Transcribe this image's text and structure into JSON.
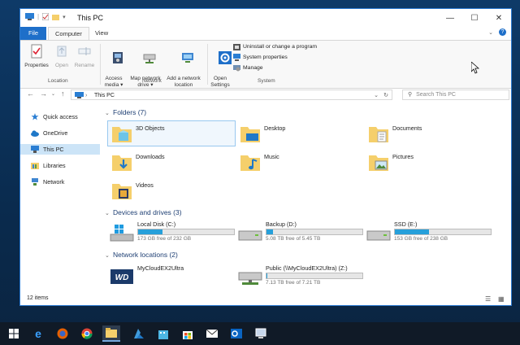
{
  "window": {
    "title": "This PC",
    "controls": {
      "minimize": "—",
      "maximize": "☐",
      "close": "✕"
    }
  },
  "ribbon": {
    "tabs": [
      "File",
      "Computer",
      "View"
    ],
    "location": {
      "label": "Location",
      "buttons": [
        {
          "label": "Properties",
          "icon": "properties-icon",
          "enabled": true
        },
        {
          "label": "Open",
          "icon": "open-icon",
          "enabled": false
        },
        {
          "label": "Rename",
          "icon": "rename-icon",
          "enabled": false
        }
      ]
    },
    "network": {
      "label": "Network",
      "buttons": [
        {
          "label": "Access\nmedia ▾",
          "icon": "access-media-icon"
        },
        {
          "label": "Map network\ndrive ▾",
          "icon": "map-network-drive-icon"
        },
        {
          "label": "Add a network\nlocation",
          "icon": "add-network-location-icon"
        }
      ]
    },
    "system": {
      "label": "System",
      "open_settings": "Open\nSettings",
      "items": [
        "Uninstall or change a program",
        "System properties",
        "Manage"
      ]
    }
  },
  "navbar": {
    "address": "This PC",
    "search_placeholder": "Search This PC"
  },
  "navpane": {
    "items": [
      {
        "label": "Quick access",
        "icon": "star-icon",
        "selected": false
      },
      {
        "label": "OneDrive",
        "icon": "cloud-icon",
        "selected": false
      },
      {
        "label": "This PC",
        "icon": "computer-icon",
        "selected": true
      },
      {
        "label": "Libraries",
        "icon": "library-icon",
        "selected": false
      },
      {
        "label": "Network",
        "icon": "network-icon",
        "selected": false
      }
    ]
  },
  "folders": {
    "header": "Folders (7)",
    "items": [
      "3D Objects",
      "Desktop",
      "Documents",
      "Downloads",
      "Music",
      "Pictures",
      "Videos"
    ]
  },
  "drives": {
    "header": "Devices and drives (3)",
    "items": [
      {
        "name": "Local Disk (C:)",
        "space": "173 GB free of 232 GB",
        "used_fraction": 0.25
      },
      {
        "name": "Backup (D:)",
        "space": "5.08 TB free of 5.45 TB",
        "used_fraction": 0.07
      },
      {
        "name": "SSD (E:)",
        "space": "153 GB free of 238 GB",
        "used_fraction": 0.36
      }
    ]
  },
  "network_locations": {
    "header": "Network locations (2)",
    "items": [
      {
        "name": "MyCloudEX2Ultra",
        "logo_text": "WD"
      },
      {
        "name": "Public (\\\\MyCloudEX2Ultra) (Z:)",
        "space": "7.13 TB free of 7.21 TB",
        "used_fraction": 0.01
      }
    ]
  },
  "statusbar": {
    "count": "12 items"
  },
  "colors": {
    "accent": "#1e6fc9",
    "selection": "#cce4f7",
    "drive_bar": "#26a0da",
    "folder": "#f5cf6b"
  }
}
